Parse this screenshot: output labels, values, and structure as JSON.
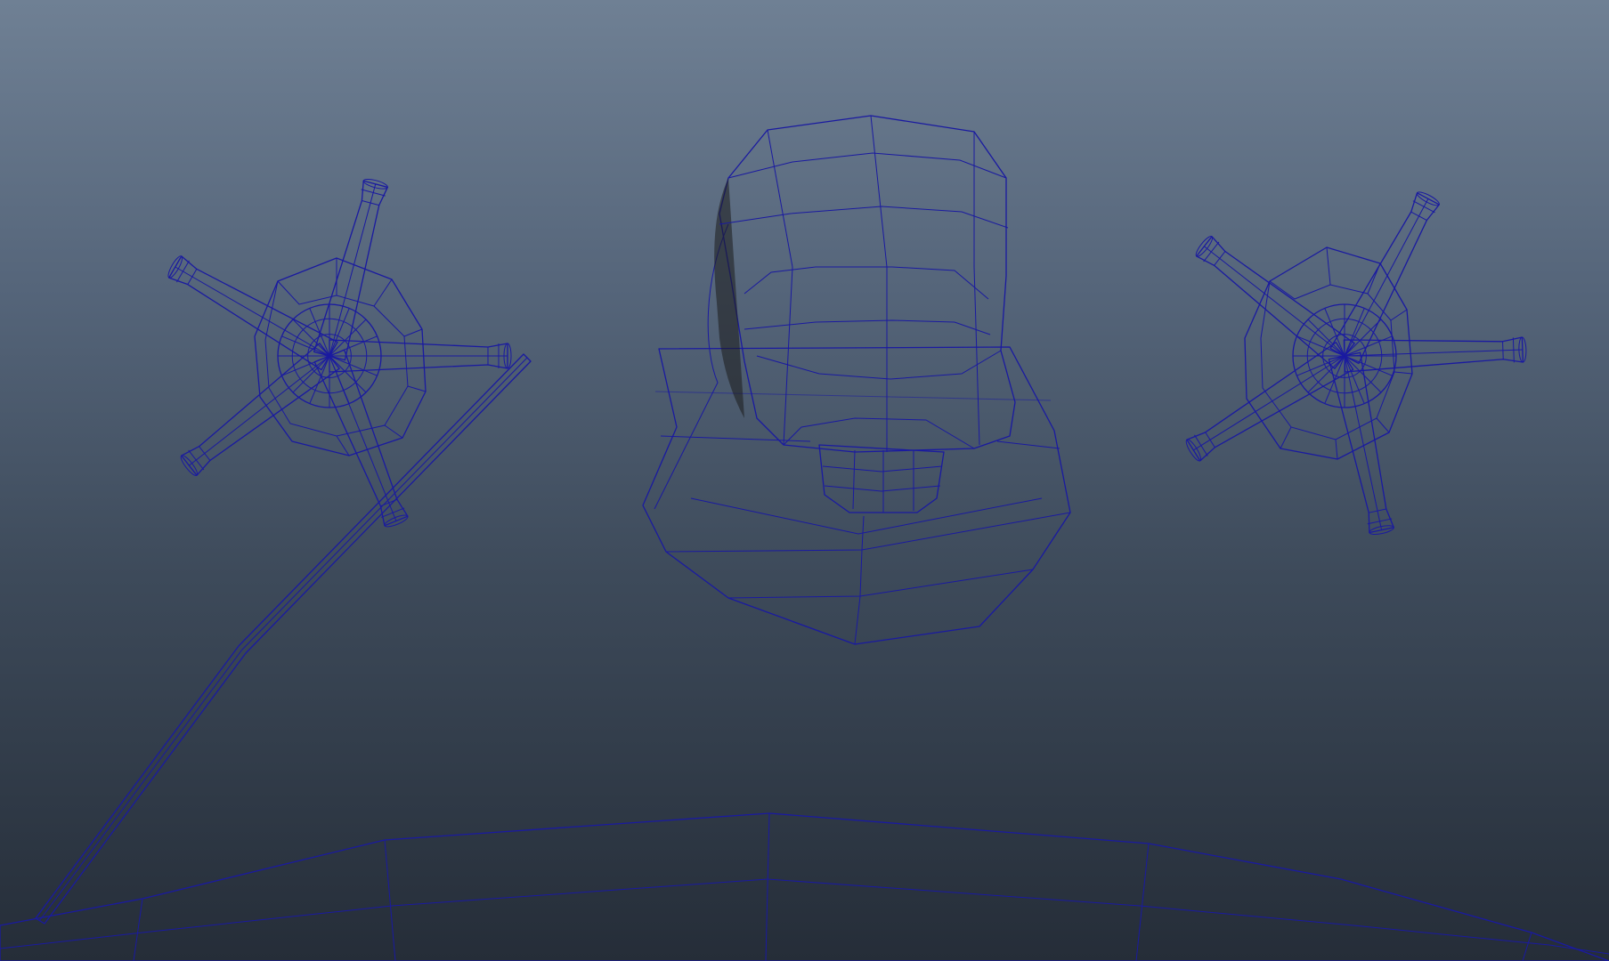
{
  "viewport": {
    "background_top": "#6f8094",
    "background_bottom": "#252d38",
    "wireframe_color": "#1a1aa0",
    "shaded_surface_color": "#8a8a8a",
    "objects": [
      "handle-left",
      "spout",
      "handle-right",
      "basin",
      "drain-rod"
    ]
  }
}
